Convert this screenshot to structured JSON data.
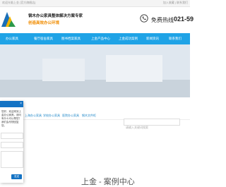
{
  "topbar": {
    "welcome": "欢迎光临上金 [官方旗舰店]",
    "links": "加入收藏 | 联系我们"
  },
  "header": {
    "slogan_line1": "钢木办公家具整体解决方案专家",
    "slogan_line2": "创造高效办公环境",
    "hotline_label": "免费热线",
    "hotline_number": "021-59"
  },
  "nav": {
    "items": [
      "办公家具",
      "餐厅宿舍家具",
      "图书档案家具",
      "上金产品中心",
      "上金成功案例",
      "新闻资讯",
      "联系我们"
    ]
  },
  "subnav": {
    "tabs": [
      "上海办公家具",
      "学校办公家具",
      "医院办公家具",
      "钢木文件柜"
    ],
    "search_placeholder": "请输入关键词搜索"
  },
  "page_title": "上金 - 案例中心",
  "chat": {
    "close": "×",
    "greeting": "您好，欢迎来到上金办公家具，请问有什么可以帮您？我们会尽快回复您。",
    "send_label": "发送"
  },
  "colors": {
    "nav_bg": "#1fa3e6",
    "chat_header": "#1473c4",
    "slogan_accent": "#f08c00"
  }
}
